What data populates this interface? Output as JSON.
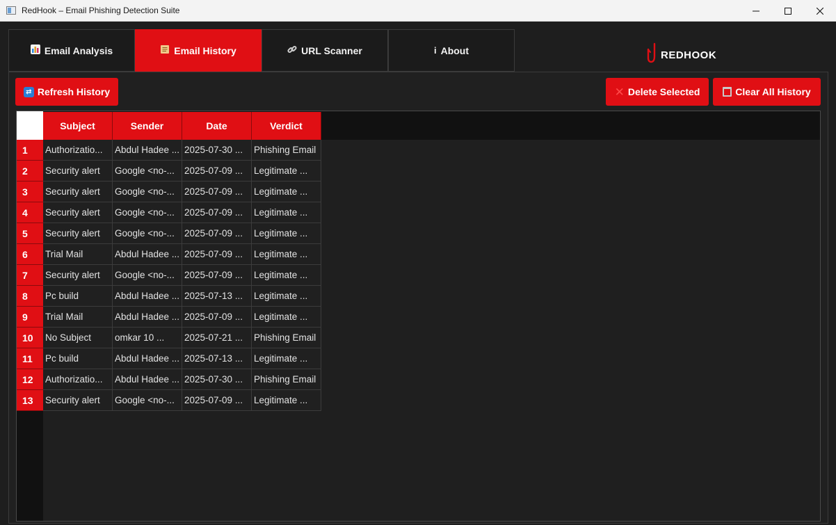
{
  "window": {
    "title": "RedHook – Email Phishing Detection Suite"
  },
  "tabs": [
    {
      "label": "Email Analysis",
      "icon": "chart-icon",
      "active": false
    },
    {
      "label": "Email History",
      "icon": "scroll-icon",
      "active": true
    },
    {
      "label": "URL Scanner",
      "icon": "link-icon",
      "active": false
    },
    {
      "label": "About",
      "icon": "info-icon",
      "active": false
    }
  ],
  "brand": {
    "text": "REDHOOK"
  },
  "toolbar": {
    "refresh_label": "Refresh History",
    "delete_label": "Delete Selected",
    "clear_label": "Clear All History"
  },
  "table": {
    "columns": [
      "Subject",
      "Sender",
      "Date",
      "Verdict"
    ],
    "rows": [
      {
        "num": "1",
        "subject": "Authorizatio...",
        "sender": "Abdul Hadee ...",
        "date": "2025-07-30 ...",
        "verdict": "Phishing Email"
      },
      {
        "num": "2",
        "subject": "Security alert",
        "sender": "Google <no-...",
        "date": "2025-07-09 ...",
        "verdict": "Legitimate ..."
      },
      {
        "num": "3",
        "subject": "Security alert",
        "sender": "Google <no-...",
        "date": "2025-07-09 ...",
        "verdict": "Legitimate ..."
      },
      {
        "num": "4",
        "subject": "Security alert",
        "sender": "Google <no-...",
        "date": "2025-07-09 ...",
        "verdict": "Legitimate ..."
      },
      {
        "num": "5",
        "subject": "Security alert",
        "sender": "Google <no-...",
        "date": "2025-07-09 ...",
        "verdict": "Legitimate ..."
      },
      {
        "num": "6",
        "subject": "Trial Mail",
        "sender": "Abdul Hadee ...",
        "date": "2025-07-09 ...",
        "verdict": "Legitimate ..."
      },
      {
        "num": "7",
        "subject": "Security alert",
        "sender": "Google <no-...",
        "date": "2025-07-09 ...",
        "verdict": "Legitimate ..."
      },
      {
        "num": "8",
        "subject": "Pc build",
        "sender": "Abdul Hadee ...",
        "date": "2025-07-13 ...",
        "verdict": "Legitimate ..."
      },
      {
        "num": "9",
        "subject": "Trial Mail",
        "sender": "Abdul Hadee ...",
        "date": "2025-07-09 ...",
        "verdict": "Legitimate ..."
      },
      {
        "num": "10",
        "subject": "No Subject",
        "sender": "omkar 10 ...",
        "date": "2025-07-21 ...",
        "verdict": "Phishing Email"
      },
      {
        "num": "11",
        "subject": "Pc build",
        "sender": "Abdul Hadee ...",
        "date": "2025-07-13 ...",
        "verdict": "Legitimate ..."
      },
      {
        "num": "12",
        "subject": "Authorizatio...",
        "sender": "Abdul Hadee ...",
        "date": "2025-07-30 ...",
        "verdict": "Phishing Email"
      },
      {
        "num": "13",
        "subject": "Security alert",
        "sender": "Google <no-...",
        "date": "2025-07-09 ...",
        "verdict": "Legitimate ..."
      }
    ]
  },
  "colors": {
    "accent": "#e00f14",
    "background": "#1e1e1e",
    "grid_line": "#3c3c3c"
  }
}
